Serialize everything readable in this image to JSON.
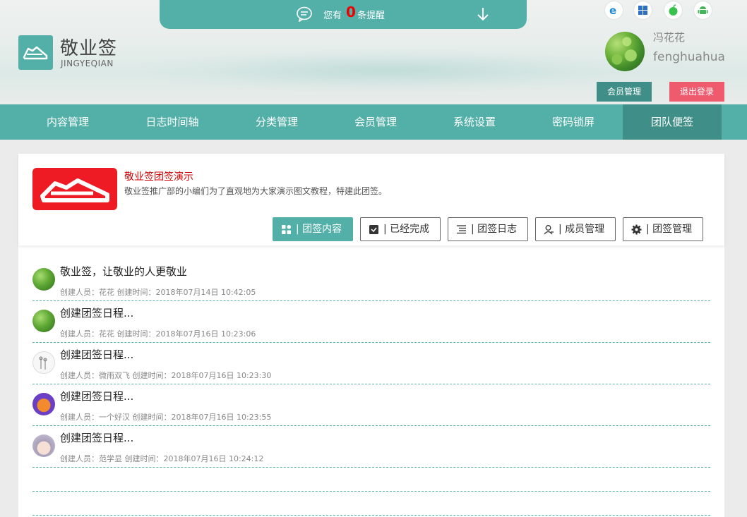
{
  "notice": {
    "prefix": "您有",
    "count": "0",
    "suffix": "条提醒"
  },
  "brand": {
    "name": "敬业签",
    "sub": "JINGYEQIAN"
  },
  "platforms": [
    "ie-icon",
    "windows-icon",
    "apple-icon",
    "android-icon"
  ],
  "user": {
    "name_cn": "冯花花",
    "name_en": "fenghuahua"
  },
  "header_buttons": {
    "member": "会员管理",
    "logout": "退出登录"
  },
  "nav": [
    {
      "label": "内容管理"
    },
    {
      "label": "日志时间轴"
    },
    {
      "label": "分类管理"
    },
    {
      "label": "会员管理"
    },
    {
      "label": "系统设置"
    },
    {
      "label": "密码锁屏"
    },
    {
      "label": "团队便签"
    }
  ],
  "team": {
    "title": "敬业签团签演示",
    "desc": "敬业签推广部的小编们为了直观地为大家演示图文教程，特建此团签。"
  },
  "tabs": [
    {
      "label": "| 团签内容"
    },
    {
      "label": "| 已经完成"
    },
    {
      "label": "| 团签日志"
    },
    {
      "label": "| 成员管理"
    },
    {
      "label": "| 团签管理"
    }
  ],
  "items": [
    {
      "title": "敬业签，让敬业的人更敬业",
      "meta": "创建人员：花花 创建时间：2018年07月14日 10:42:05"
    },
    {
      "title": "创建团签日程...",
      "meta": "创建人员：花花 创建时间：2018年07月16日 10:23:06"
    },
    {
      "title": "创建团签日程...",
      "meta": "创建人员：微雨双飞 创建时间：2018年07月16日 10:23:30"
    },
    {
      "title": "创建团签日程...",
      "meta": "创建人员：一个好汉 创建时间：2018年07月16日 10:23:55"
    },
    {
      "title": "创建团签日程...",
      "meta": "创建人员：范学显 创建时间：2018年07月16日 10:24:12"
    }
  ],
  "colors": {
    "accent": "#53b0a8",
    "accent_dark": "#3f8f88",
    "logout": "#f05a6d",
    "alert": "#ee0000"
  }
}
